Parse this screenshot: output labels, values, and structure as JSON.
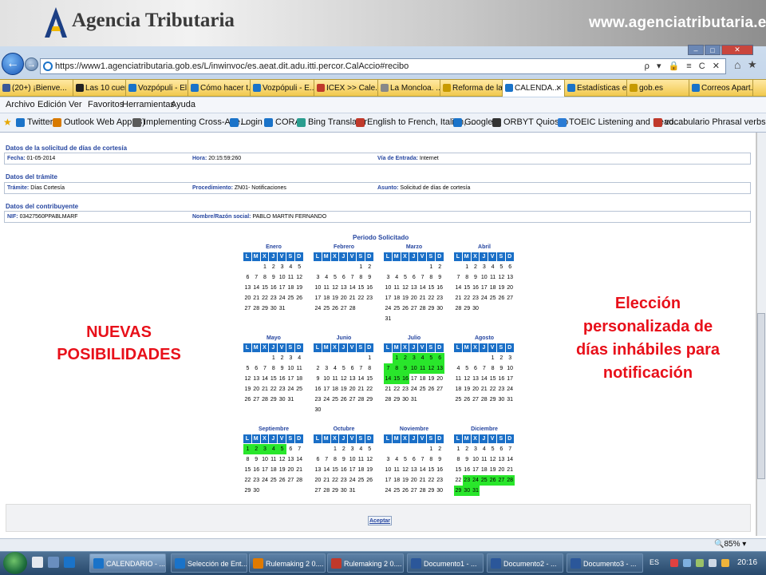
{
  "banner": {
    "brand": "Agencia Tributaria",
    "site_url": "www.agenciatributaria.es"
  },
  "browser": {
    "url": "https://www1.agenciatributaria.gob.es/L/inwinvoc/es.aeat.dit.adu.itti.percor.CalAccio#recibo",
    "addr_tools": "ρ ▾ 🔒 ≡ C ✕",
    "tabs": [
      {
        "label": "(20+) ¡Bienve...",
        "color": "#3b5998"
      },
      {
        "label": "Las 10 cuenta...",
        "color": "#222"
      },
      {
        "label": "Vozpópuli - El...",
        "color": "#1a73c9"
      },
      {
        "label": "Cómo hacer t...",
        "color": "#1a73c9"
      },
      {
        "label": "Vozpópuli - E...",
        "color": "#1a73c9"
      },
      {
        "label": "ICEX >> Cale...",
        "color": "#c0392b"
      },
      {
        "label": "La Moncloa. ...",
        "color": "#888"
      },
      {
        "label": "Reforma de la...",
        "color": "#c79a00"
      },
      {
        "label": "CALENDA...",
        "color": "#1a73c9"
      },
      {
        "label": "Estadísticas e ...",
        "color": "#1a73c9"
      },
      {
        "label": "gob.es",
        "color": "#c79a00"
      },
      {
        "label": "Correos Apart...",
        "color": "#1a73c9"
      }
    ],
    "close_tab": "✕",
    "menu": [
      "Archivo",
      "Edición",
      "Ver",
      "Favoritos",
      "Herramientas",
      "Ayuda"
    ],
    "favorites": [
      {
        "label": "Twitter",
        "color": "#1a73c9"
      },
      {
        "label": "Outlook Web App (3)",
        "color": "#d87a00"
      },
      {
        "label": "Implementing Cross-Age...",
        "color": "#5a5a5a"
      },
      {
        "label": "Login",
        "color": "#1a73c9"
      },
      {
        "label": "CORA",
        "color": "#1a73c9"
      },
      {
        "label": "Bing Translator",
        "color": "#2a9d8f"
      },
      {
        "label": "English to French, Italian, ...",
        "color": "#c0392b"
      },
      {
        "label": "Google",
        "color": "#1a73c9"
      },
      {
        "label": "ORBYT Quiosco",
        "color": "#333"
      },
      {
        "label": "TOEIC Listening and Read...",
        "color": "#2a7bd4"
      },
      {
        "label": "vocabulario Phrasal verbs ...",
        "color": "#c0392b"
      }
    ],
    "zoom": "85%"
  },
  "form": {
    "solicitud": {
      "title": "Datos de la solicitud de días de cortesía",
      "fecha_label": "Fecha:",
      "fecha_value": "01-05-2014",
      "hora_label": "Hora:",
      "hora_value": "20:15:59:260",
      "via_label": "Vía de Entrada:",
      "via_value": "Internet"
    },
    "tramite": {
      "title": "Datos del trámite",
      "tramite_label": "Trámite:",
      "tramite_value": "Días Cortesía",
      "proc_label": "Procedimiento:",
      "proc_value": "ZN01- Notificaciones",
      "asunto_label": "Asunto:",
      "asunto_value": "Solicitud de días de cortesía"
    },
    "contribuyente": {
      "title": "Datos del contribuyente",
      "nif_label": "NIF:",
      "nif_value": "03427560PPABLMARF",
      "nombre_label": "Nombre/Razón social:",
      "nombre_value": "PABLO MARTIN FERNANDO"
    },
    "periodo": "Periodo Solicitado",
    "weekday_headers": [
      "L",
      "M",
      "X",
      "J",
      "V",
      "S",
      "D"
    ],
    "aceptar": "Aceptar"
  },
  "months": [
    {
      "name": "Enero",
      "offset": 2,
      "days": 31,
      "selected": []
    },
    {
      "name": "Febrero",
      "offset": 5,
      "days": 28,
      "selected": []
    },
    {
      "name": "Marzo",
      "offset": 5,
      "days": 31,
      "selected": []
    },
    {
      "name": "Abril",
      "offset": 1,
      "days": 30,
      "selected": []
    },
    {
      "name": "Mayo",
      "offset": 3,
      "days": 31,
      "selected": []
    },
    {
      "name": "Junio",
      "offset": 6,
      "days": 30,
      "selected": []
    },
    {
      "name": "Julio",
      "offset": 1,
      "days": 31,
      "selected": [
        1,
        2,
        3,
        4,
        5,
        6,
        7,
        8,
        9,
        10,
        11,
        12,
        13,
        14,
        15,
        16
      ]
    },
    {
      "name": "Agosto",
      "offset": 4,
      "days": 31,
      "selected": []
    },
    {
      "name": "Septiembre",
      "offset": 0,
      "days": 30,
      "selected": [
        1,
        2,
        3,
        4,
        5
      ]
    },
    {
      "name": "Octubre",
      "offset": 2,
      "days": 31,
      "selected": []
    },
    {
      "name": "Noviembre",
      "offset": 5,
      "days": 30,
      "selected": []
    },
    {
      "name": "Diciembre",
      "offset": 0,
      "days": 31,
      "selected": [
        23,
        24,
        25,
        26,
        27,
        28,
        29,
        30,
        31
      ]
    }
  ],
  "overlay": {
    "left": "NUEVAS POSIBILIDADES",
    "right": "Elección personalizada de días inhábiles para notificación"
  },
  "taskbar": {
    "items": [
      {
        "label": "CALENDARIO - ...",
        "color": "#1a73c9"
      },
      {
        "label": "Selección de Ent...",
        "color": "#1a73c9"
      },
      {
        "label": "Rulemaking 2 0....",
        "color": "#e07a00"
      },
      {
        "label": "Rulemaking 2 0....",
        "color": "#c0392b"
      },
      {
        "label": "Documento1 - ...",
        "color": "#2b579a"
      },
      {
        "label": "Documento2 - ...",
        "color": "#2b579a"
      },
      {
        "label": "Documento3 - ...",
        "color": "#2b579a"
      }
    ],
    "lang": "ES",
    "clock": "20:16"
  }
}
